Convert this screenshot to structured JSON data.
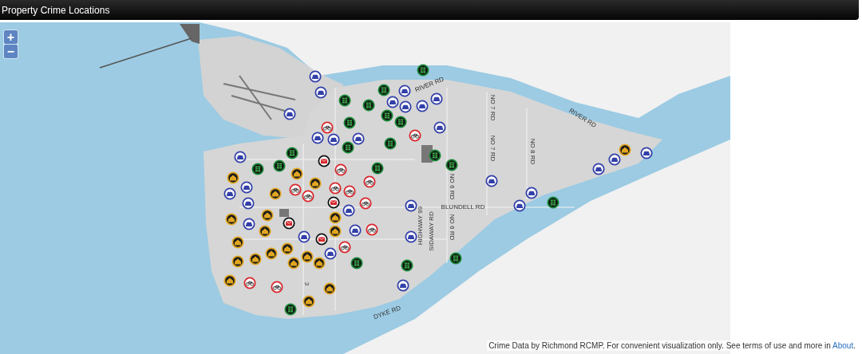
{
  "header": {
    "title": "Property Crime Locations"
  },
  "zoom_controls": [
    "+",
    "−"
  ],
  "road_labels": [
    "RIVER RD",
    "RIVER RD",
    "NO 7 RD",
    "NO 7 RD",
    "NO 8 RD",
    "BLUNDELL RD",
    "HIGHWAY 99",
    "SIDAWAY RD",
    "NO 6 RD",
    "NO 6 RD",
    "DYKE RD",
    "3"
  ],
  "attribution": {
    "text": "Crime Data by Richmond RCMP. For convenient visualization only. See terms of use and more in",
    "link": "About",
    "text_after": "."
  }
}
